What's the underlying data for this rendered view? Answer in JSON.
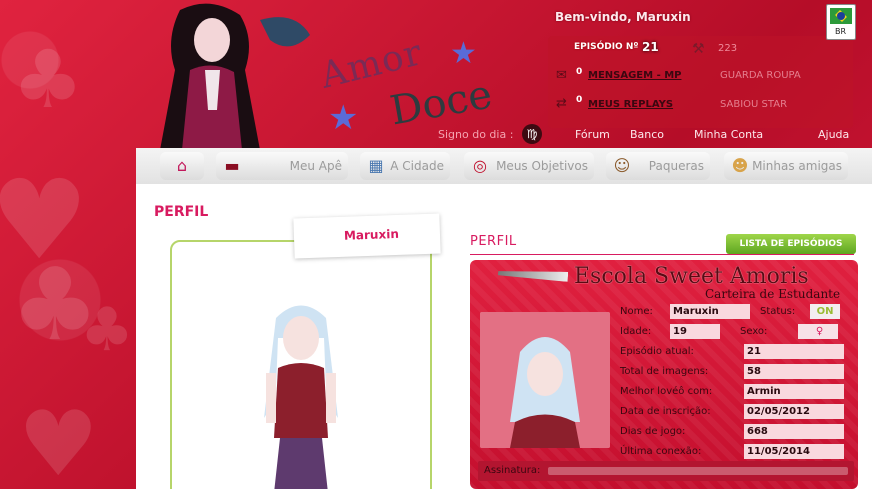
{
  "header": {
    "welcome": "Bem-vindo, Maruxin",
    "episode_label": "EPISÓDIO Nº",
    "episode_number": "21",
    "pa_value": "223",
    "links": [
      {
        "count": "0",
        "label": "MENSAGEM - MP"
      },
      {
        "count": "0",
        "label": "MEUS REPLAYS"
      }
    ],
    "faded_items": [
      "GUARDA ROUPA",
      "SABIOU STAR"
    ],
    "signo_label": "Signo do dia :",
    "signo_symbol": "♍",
    "nav_links": [
      "Fórum",
      "Banco",
      "Minha Conta",
      "Ajuda"
    ],
    "flag_label": "BR",
    "logo_top": "Amor",
    "logo_bottom": "Doce"
  },
  "nav": {
    "items": [
      {
        "label": "",
        "icon": "home-icon"
      },
      {
        "label": "Meu Apê",
        "icon": "sofa-icon"
      },
      {
        "label": "A Cidade",
        "icon": "city-icon"
      },
      {
        "label": "Meus Objetivos",
        "icon": "target-icon"
      },
      {
        "label": "Paqueras",
        "icon": "boy-face-icon"
      },
      {
        "label": "Minhas amigas",
        "icon": "girl-face-icon"
      }
    ]
  },
  "page": {
    "title": "PERFIL",
    "section_title": "PERFIL",
    "username": "Maruxin",
    "episodes_button": "LISTA DE EPISÓDIOS"
  },
  "card": {
    "school": "Escola Sweet Amoris",
    "subtitle": "Carteira de Estudante",
    "fields": {
      "nome_label": "Nome:",
      "nome": "Maruxin",
      "status_label": "Status:",
      "status": "ON",
      "idade_label": "Idade:",
      "idade": "19",
      "sexo_label": "Sexo:",
      "sexo_symbol": "♀",
      "episodio_label": "Episódio atual:",
      "episodio": "21",
      "imagens_label": "Total de imagens:",
      "imagens": "58",
      "loved_label": "Melhor lovéô com:",
      "loved": "Armin",
      "inscricao_label": "Data de inscrição:",
      "inscricao": "02/05/2012",
      "dias_label": "Dias de jogo:",
      "dias": "668",
      "conexao_label": "Última conexão:",
      "conexao": "11/05/2014"
    },
    "signature_label": "Assinatura:"
  },
  "colors": {
    "accent": "#d81b60",
    "background": "#c8102e",
    "nav_green": "#7fc33a",
    "card_border": "#b6d56a"
  }
}
